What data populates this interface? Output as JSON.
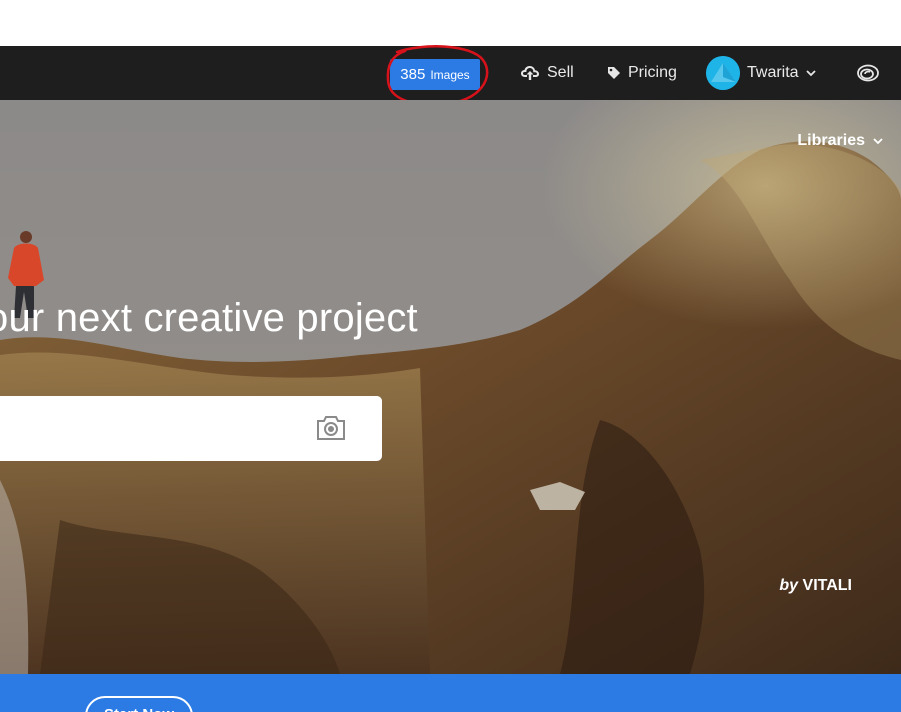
{
  "navbar": {
    "images_count": "385",
    "images_unit": "Images",
    "sell_label": "Sell",
    "pricing_label": "Pricing",
    "user_name": "Twarita",
    "icons": {
      "sell": "cloud-upload-icon",
      "pricing": "tag-icon",
      "user_menu": "chevron-down-icon",
      "creative_cloud": "creative-cloud-icon"
    }
  },
  "hero": {
    "libraries_label": "Libraries",
    "headline": "our next creative project",
    "search": {
      "value": "",
      "placeholder": ""
    },
    "credit_by": "by",
    "credit_name": "VITALI"
  },
  "footer_bar": {
    "start_button_label": "Start Now"
  },
  "colors": {
    "nav_background": "#1e1e1e",
    "accent_blue": "#2c7be5",
    "annotation_red": "#d8121a",
    "avatar": "#1fb4e8"
  }
}
